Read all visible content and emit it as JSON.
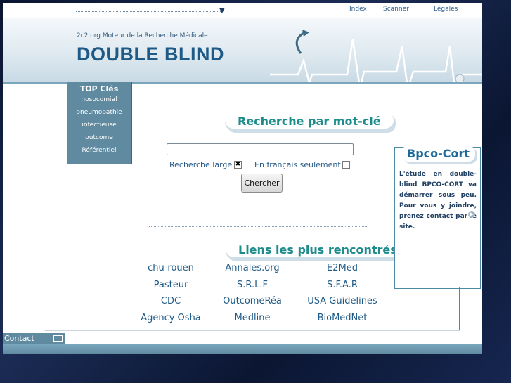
{
  "nav": {
    "index": "Index",
    "scanner": "Scanner",
    "legales": "Légales"
  },
  "header": {
    "subtitle": "2c2.org Moteur de la Recherche Médicale",
    "title": "DOUBLE BLIND"
  },
  "topcles": {
    "title": "TOP Clés",
    "items": [
      "nosocomial",
      "pneumopathie",
      "infectieuse",
      "outcome",
      "Référentiel"
    ]
  },
  "search": {
    "title": "Recherche par mot-clé",
    "input_value": "",
    "option_large": "Recherche large",
    "option_large_checked": true,
    "option_fr": "En français seulement",
    "option_fr_checked": false,
    "button": "Chercher"
  },
  "links": {
    "title": "Liens les plus rencontrés",
    "items": [
      [
        "chu-rouen",
        "Annales.org",
        "E2Med"
      ],
      [
        "Pasteur",
        "S.R.L.F",
        "S.F.A.R"
      ],
      [
        "CDC",
        "OutcomeRéa",
        "USA Guidelines"
      ],
      [
        "Agency Osha",
        "Medline",
        "BioMedNet"
      ]
    ]
  },
  "bpco": {
    "title": "Bpco-Cort",
    "text": "L'étude en double-blind BPCO-CORT va démarrer sous peu. Pour vous y joindre, prenez contact par le site."
  },
  "footer": {
    "contact": "Contact"
  },
  "colors": {
    "accent": "#1f5a86",
    "teal": "#1f8c8c",
    "sidebar": "#5f8aa0"
  }
}
